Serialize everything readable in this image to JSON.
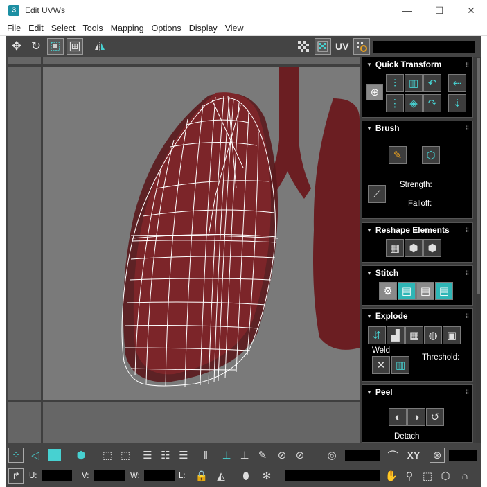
{
  "window": {
    "title": "Edit UVWs",
    "app_icon": "3",
    "controls": {
      "minimize": "—",
      "maximize": "☐",
      "close": "✕"
    }
  },
  "menu": [
    "File",
    "Edit",
    "Select",
    "Tools",
    "Mapping",
    "Options",
    "Display",
    "View"
  ],
  "toolbar": {
    "uv_label": "UV"
  },
  "panel": {
    "quick_transform": {
      "title": "Quick Transform"
    },
    "brush": {
      "title": "Brush",
      "strength_label": "Strength:",
      "falloff_label": "Falloff:"
    },
    "reshape": {
      "title": "Reshape Elements"
    },
    "stitch": {
      "title": "Stitch"
    },
    "explode": {
      "title": "Explode",
      "weld_label": "Weld",
      "threshold_label": "Threshold:"
    },
    "peel": {
      "title": "Peel",
      "detach_label": "Detach"
    }
  },
  "bottom": {
    "xy_label": "XY",
    "u_label": "U:",
    "v_label": "V:",
    "w_label": "W:",
    "l_label": "L:"
  },
  "colors": {
    "accent": "#47d1d1",
    "background": "#444444",
    "viewport": "#666666",
    "tissue": "#6b1e22"
  }
}
